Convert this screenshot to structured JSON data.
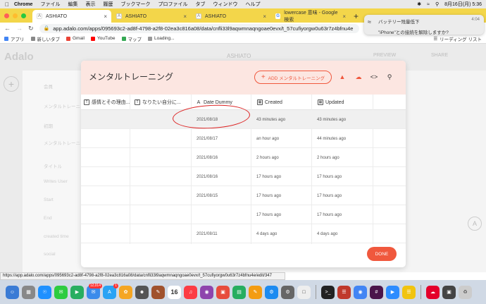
{
  "menubar": {
    "app": "Chrome",
    "items": [
      "ファイル",
      "編集",
      "表示",
      "履歴",
      "ブックマーク",
      "プロファイル",
      "タブ",
      "ウィンドウ",
      "ヘルプ"
    ],
    "clock": "8月16日(月) 5:36"
  },
  "tabs": [
    {
      "label": "ASHIATO",
      "active": true
    },
    {
      "label": "ASHIATO",
      "active": false
    },
    {
      "label": "ASHIATO",
      "active": false
    },
    {
      "label": "lowercase 意味 - Google 検索",
      "active": false
    }
  ],
  "address": {
    "url": "app.adalo.com/apps/095693c2-ad8f-4798-a2f8-02ea3c816a08/data/cnfli33l9aqwmnaqngoae0evx/t_57cufiyorgw0u63r7z4bfnu4e"
  },
  "bookmarks": {
    "items": [
      "アプリ",
      "新しいタブ",
      "Gmail",
      "YouTube",
      "マップ",
      "Loading..."
    ],
    "reading_list": "リーディング リスト"
  },
  "notification": {
    "title": "バッテリー残量低下",
    "body": "\"iPhone\"との接続を解除しますか?",
    "time": "4:04"
  },
  "editor": {
    "app_name": "ASHIATO",
    "preview": "PREVIEW",
    "share": "SHARE",
    "sidebar_items": [
      "会員",
      "メンタルトレーニング",
      "初期",
      "メンタルトレーニング",
      "タイトル",
      "Writes User",
      "Start",
      "End",
      "created time",
      "social"
    ]
  },
  "modal": {
    "title": "メンタルトレーニング",
    "add_button": "ADD メンタルトレーニング",
    "columns": [
      "感情とその理由...",
      "なりたい自分に...",
      "Date Dummy",
      "Created",
      "Updated"
    ],
    "rows": [
      {
        "date": "2021/08/18",
        "created": "43 minutes ago",
        "updated": "43 minutes ago",
        "selected": true
      },
      {
        "date": "2021/08/17",
        "created": "an hour ago",
        "updated": "44 minutes ago",
        "selected": false
      },
      {
        "date": "2021/08/16",
        "created": "2 hours ago",
        "updated": "2 hours ago",
        "selected": false
      },
      {
        "date": "2021/08/16",
        "created": "17 hours ago",
        "updated": "17 hours ago",
        "selected": false
      },
      {
        "date": "2021/08/15",
        "created": "17 hours ago",
        "updated": "17 hours ago",
        "selected": false
      },
      {
        "date": "",
        "created": "17 hours ago",
        "updated": "17 hours ago",
        "selected": false
      },
      {
        "date": "2021/08/11",
        "created": "4 days ago",
        "updated": "4 days ago",
        "selected": false
      }
    ],
    "done_button": "DONE"
  },
  "status_url": "https://app.adalo.com/apps/095693c2-ad8f-4798-a2f8-02ea3c816a08/data/cnfli33l9aqwmnaqngoae0evx/t_57cufiyorgw0u63r7z4bfnu4e/edit/347",
  "dock": {
    "mail_badge": "12,014",
    "appstore_badge": "1",
    "calendar_day": "16"
  },
  "colors": {
    "accent": "#f0583d",
    "modal_header": "#fce6e1",
    "annotation": "#dd2222",
    "tab_strip": "#f3d64a"
  }
}
